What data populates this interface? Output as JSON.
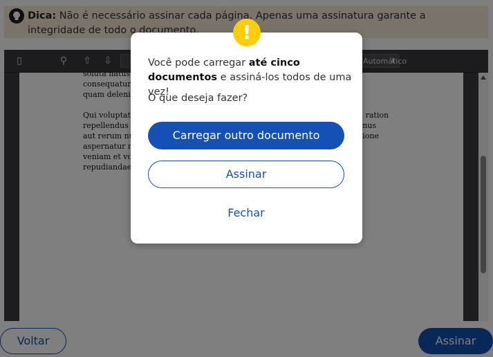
{
  "tip": {
    "label": "Dica:",
    "text": " Não é necessário assinar cada página. Apenas uma assinatura garante a integridade de todo o documento."
  },
  "viewer": {
    "zoom": "Automático",
    "document_text": "soluta natus recusandae harum ut reiciendis voluptatibus maiores alias consequatur aut\nquam deleniti.\n\nQui voluptatibus exercitationem veritatis ratione quo in nihil iure et rem ration\nrepellendus blanditiis. Sint minima quo voluptas rerum nisi quos. Est minus\naut rerum numquam dolor et dolores magni. Unde reiciendis eveniet ratione\naspernatur nam sequi voluptatem ipsam, illum ut sit porro doloremque\nveniam et voluptatem odio recusandae. Atque ipsum dolor doloremque\nrepudiandae!"
  },
  "footer": {
    "back_label": "Voltar",
    "sign_label": "Assinar"
  },
  "modal": {
    "message_prefix": "Você pode carregar ",
    "message_bold": "até cinco documentos",
    "message_suffix": " e assiná-los todos de uma vez!",
    "question": "O que deseja fazer?",
    "primary_label": "Carregar outro documento",
    "secondary_label": "Assinar",
    "close_label": "Fechar"
  },
  "colors": {
    "primary": "#1351b4",
    "warning": "#ffcd07",
    "tip_background": "#f3e6d2"
  }
}
